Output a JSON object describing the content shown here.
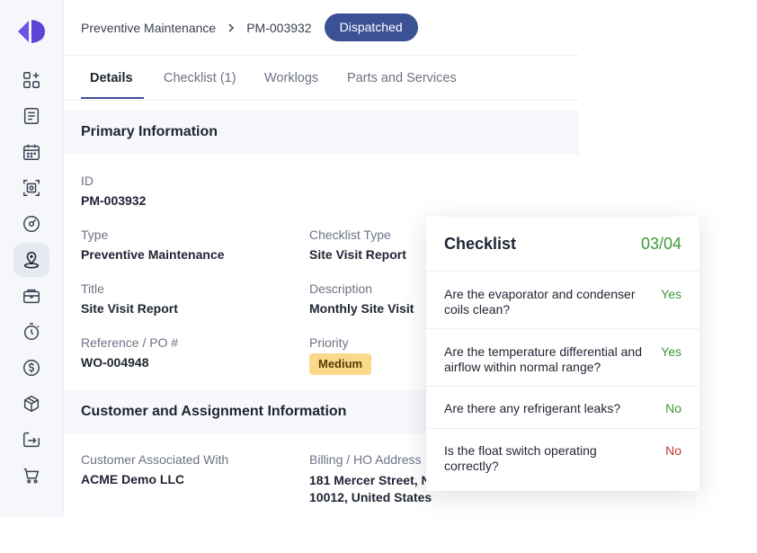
{
  "breadcrumb": {
    "parent": "Preventive Maintenance",
    "current": "PM-003932",
    "status": "Dispatched"
  },
  "tabs": [
    {
      "label": "Details"
    },
    {
      "label": "Checklist (1)"
    },
    {
      "label": "Worklogs"
    },
    {
      "label": "Parts and Services"
    }
  ],
  "primary": {
    "title": "Primary Information",
    "id_label": "ID",
    "id_value": "PM-003932",
    "type_label": "Type",
    "type_value": "Preventive Maintenance",
    "checklist_type_label": "Checklist Type",
    "checklist_type_value": "Site Visit Report",
    "title_label": "Title",
    "title_value": "Site Visit Report",
    "description_label": "Description",
    "description_value": "Monthly Site Visit",
    "reference_label": "Reference / PO #",
    "reference_value": "WO-004948",
    "priority_label": "Priority",
    "priority_value": "Medium"
  },
  "customer": {
    "title": "Customer and Assignment Information",
    "customer_label": "Customer Associated With",
    "customer_value": "ACME Demo LLC",
    "billing_label": "Billing / HO Address",
    "billing_line1": "181 Mercer Street, N",
    "billing_line2": "10012, United States"
  },
  "checklist": {
    "title": "Checklist",
    "count": "03/04",
    "items": [
      {
        "question": "Are the evaporator and condenser coils clean?",
        "answer": "Yes"
      },
      {
        "question": "Are the temperature differential and airflow within normal range?",
        "answer": "Yes"
      },
      {
        "question": "Are there any refrigerant leaks?",
        "answer": "No"
      },
      {
        "question": "Is the float switch operating correctly?",
        "answer": "No"
      }
    ]
  },
  "colors": {
    "accent": "#3b5196",
    "success": "#3b9a3b",
    "danger": "#c0392b",
    "priority_bg": "#fbd98b"
  },
  "icons": [
    "logo",
    "widgets-icon",
    "document-icon",
    "calendar-icon",
    "scan-icon",
    "gauge-icon",
    "location-icon",
    "briefcase-icon",
    "timer-icon",
    "dollar-icon",
    "box-icon",
    "import-icon",
    "cart-icon"
  ]
}
